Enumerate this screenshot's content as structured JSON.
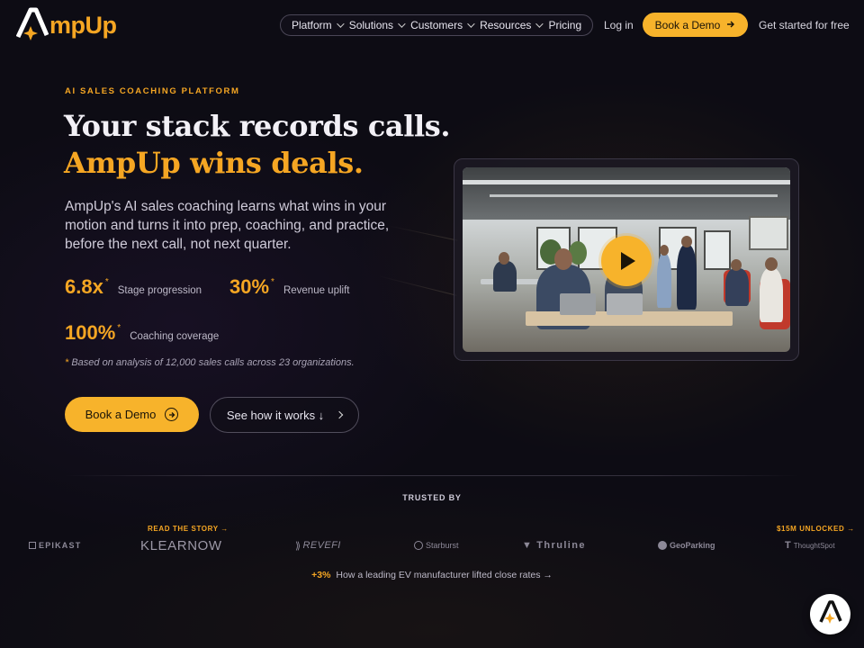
{
  "brand": {
    "name": "mpUp",
    "accent": "#f5a623",
    "bg": "#0d0c14"
  },
  "nav": {
    "menu": [
      {
        "label": "Platform",
        "dropdown": true
      },
      {
        "label": "Solutions",
        "dropdown": true
      },
      {
        "label": "Customers",
        "dropdown": true
      },
      {
        "label": "Resources",
        "dropdown": true
      },
      {
        "label": "Pricing",
        "dropdown": false
      }
    ],
    "login": "Log in",
    "demo": "Book a Demo",
    "demo_icon": "arrow-right-icon",
    "free": "Get started for free"
  },
  "hero": {
    "eyebrow": "AI SALES COACHING PLATFORM",
    "title_line1": "Your stack records calls.",
    "title_line2": "AmpUp wins deals.",
    "lede": "AmpUp's AI sales coaching learns what wins in your motion and turns it into prep, coaching, and practice, before the next call, not next quarter.",
    "stats": [
      {
        "value": "6.8x",
        "mark": "*",
        "label": "Stage progression"
      },
      {
        "value": "30%",
        "mark": "*",
        "label": "Revenue uplift"
      },
      {
        "value": "100%",
        "mark": "*",
        "label": "Coaching coverage"
      }
    ],
    "footnote_mark": "*",
    "footnote": "Based on analysis of 12,000 sales calls across 23 organizations.",
    "cta_primary": "Book a Demo",
    "cta_primary_icon": "arrow-circle-right-icon",
    "cta_secondary": "See how it works ↓",
    "cta_secondary_icon": "chevron-right-icon"
  },
  "video": {
    "play_icon": "play-icon"
  },
  "trusted": {
    "heading": "TRUSTED BY",
    "logos": [
      "EPIKAST",
      "KLEARNOW",
      "REVEFI",
      "Starburst",
      "Thruline",
      "GeoParking",
      "ThoughtSpot"
    ],
    "tags": [
      {
        "text": "READ THE STORY →"
      },
      {
        "text": "$15M UNLOCKED →"
      }
    ],
    "story_pct": "+3%",
    "story_text": "How a leading EV manufacturer lifted close rates →"
  },
  "chat": {
    "icon": "ampup-chat-icon"
  }
}
